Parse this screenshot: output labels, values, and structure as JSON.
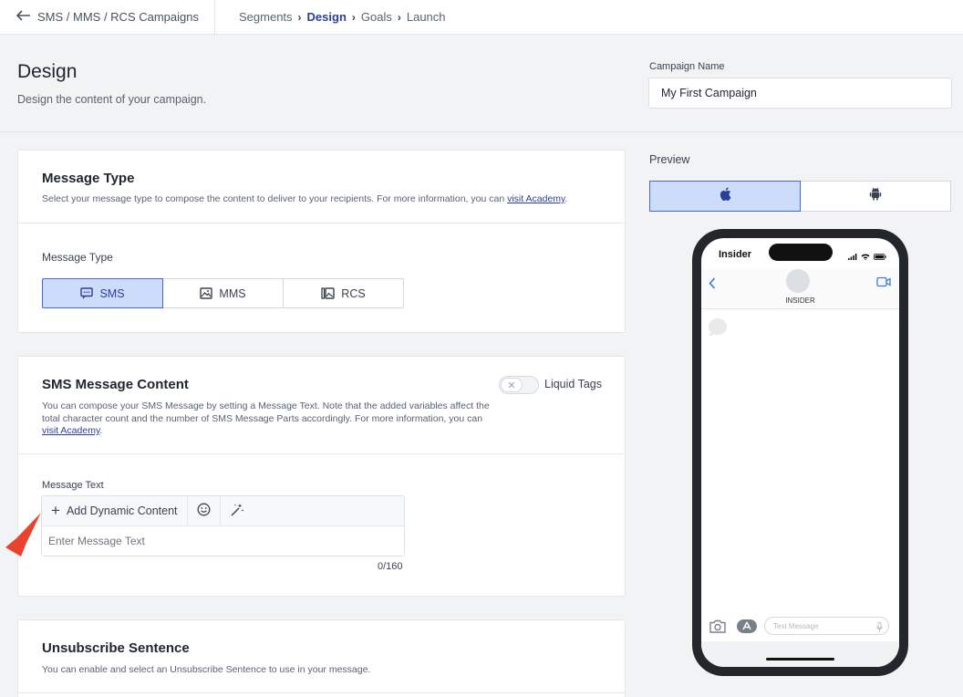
{
  "topbar": {
    "back_label": "SMS / MMS / RCS Campaigns",
    "breadcrumbs": [
      {
        "label": "Segments",
        "active": false
      },
      {
        "label": "Design",
        "active": true
      },
      {
        "label": "Goals",
        "active": false
      },
      {
        "label": "Launch",
        "active": false
      }
    ]
  },
  "header": {
    "title": "Design",
    "subtitle": "Design the content of your campaign.",
    "campaign_name_label": "Campaign Name",
    "campaign_name_value": "My First Campaign"
  },
  "message_type": {
    "title": "Message Type",
    "description": "Select your message type to compose the content to deliver to your recipients. For more information, you can ",
    "link": "visit Academy",
    "suffix": ".",
    "field_label": "Message Type",
    "options": [
      {
        "label": "SMS",
        "icon": "sms-icon",
        "selected": true
      },
      {
        "label": "MMS",
        "icon": "image-icon",
        "selected": false
      },
      {
        "label": "RCS",
        "icon": "rcs-icon",
        "selected": false
      }
    ]
  },
  "sms_content": {
    "title": "SMS Message Content",
    "description": "You can compose your SMS Message by setting a Message Text. Note that the added variables affect the total character count and the number of SMS Message Parts accordingly. For more information, you can ",
    "link": "visit Academy",
    "suffix": ".",
    "toggle_label": "Liquid Tags",
    "message_text_label": "Message Text",
    "add_dynamic_label": "Add Dynamic Content",
    "placeholder": "Enter Message Text",
    "counter": "0/160"
  },
  "unsubscribe": {
    "title": "Unsubscribe Sentence",
    "description": "You can enable and select an Unsubscribe Sentence to use in your message."
  },
  "preview": {
    "label": "Preview",
    "os_options": [
      {
        "icon": "apple-icon",
        "selected": true
      },
      {
        "icon": "android-icon",
        "selected": false
      }
    ],
    "phone": {
      "carrier": "Insider",
      "contact_name": "INSIDER",
      "compose_placeholder": "Text Message"
    }
  },
  "colors": {
    "accent": "#2a3f9a",
    "selected_bg": "#cddcfb",
    "selected_border": "#4667d6",
    "pointer": "#e8432f"
  }
}
